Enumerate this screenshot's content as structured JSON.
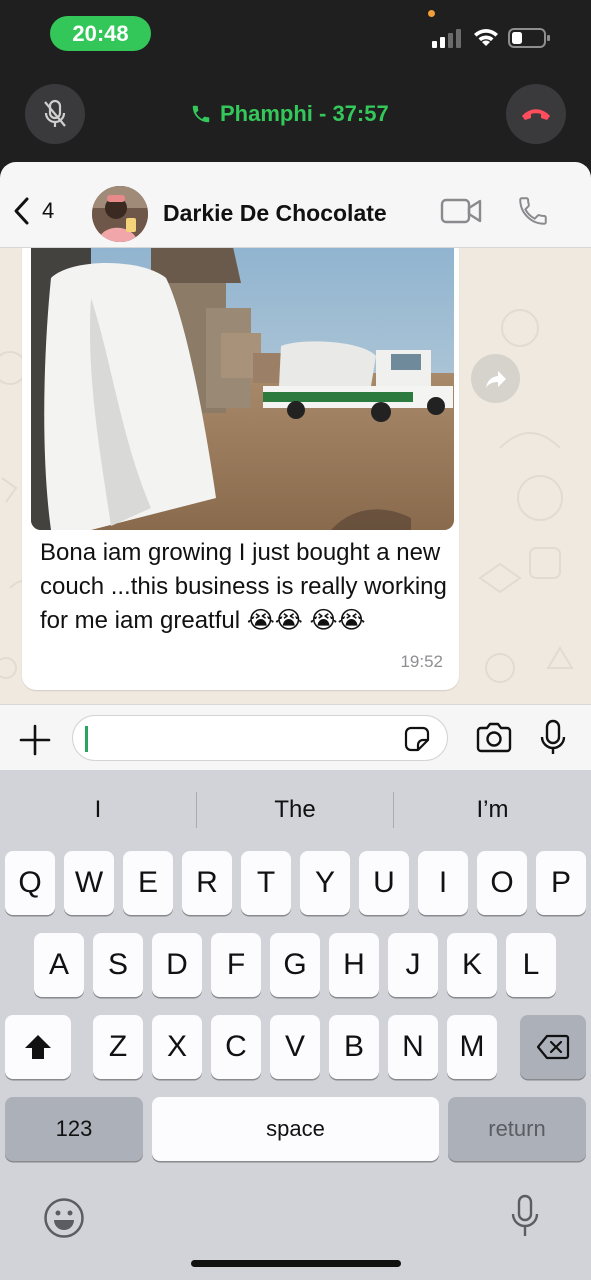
{
  "status_bar": {
    "time": "20:48",
    "icons": [
      "signal-icon",
      "wifi-icon",
      "battery-icon"
    ]
  },
  "call": {
    "label": "Phamphi - 37:57",
    "accent": "#34c759"
  },
  "header": {
    "back_count": "4",
    "contact_name": "Darkie De Chocolate"
  },
  "message": {
    "text": "Bona iam growing I just bought a new couch ...this business is really working for me iam greatful 😭😭 😭😭",
    "time": "19:52"
  },
  "keyboard": {
    "suggestions": [
      "I",
      "The",
      "I’m"
    ],
    "row1": [
      "Q",
      "W",
      "E",
      "R",
      "T",
      "Y",
      "U",
      "I",
      "O",
      "P"
    ],
    "row2": [
      "A",
      "S",
      "D",
      "F",
      "G",
      "H",
      "J",
      "K",
      "L"
    ],
    "row3": [
      "Z",
      "X",
      "C",
      "V",
      "B",
      "N",
      "M"
    ],
    "numbers_label": "123",
    "space_label": "space",
    "return_label": "return"
  }
}
